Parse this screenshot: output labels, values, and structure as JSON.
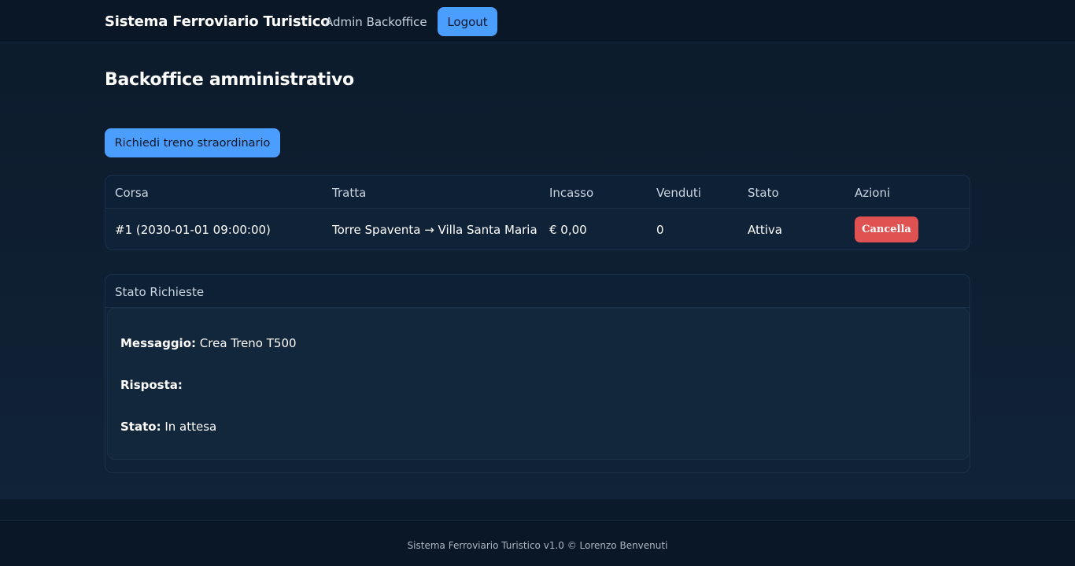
{
  "header": {
    "brand": "Sistema Ferroviario Turistico",
    "nav_link": "Admin Backoffice",
    "logout_label": "Logout"
  },
  "main": {
    "title": "Backoffice amministrativo",
    "request_button": "Richiedi treno straordinario"
  },
  "table": {
    "columns": [
      "Corsa",
      "Tratta",
      "Incasso",
      "Venduti",
      "Stato",
      "Azioni"
    ],
    "rows": [
      {
        "corsa": "#1 (2030-01-01 09:00:00)",
        "tratta": "Torre Spaventa → Villa Santa Maria",
        "incasso": "€ 0,00",
        "venduti": "0",
        "stato": "Attiva",
        "azione": "Cancella"
      }
    ]
  },
  "status": {
    "title": "Stato Richieste",
    "message_label": "Messaggio:",
    "message_value": "Crea Treno T500",
    "response_label": "Risposta:",
    "response_value": "",
    "state_label": "Stato:",
    "state_value": "In attesa"
  },
  "footer": {
    "text": "Sistema Ferroviario Turistico v1.0 © Lorenzo Benvenuti"
  },
  "colors": {
    "accent": "#4a9eff",
    "danger": "#e05252",
    "background": "#0c1b2b"
  }
}
